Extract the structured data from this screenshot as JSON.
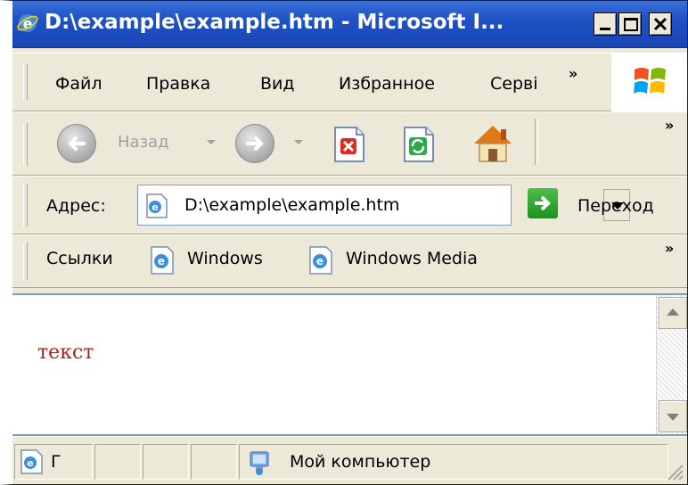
{
  "window": {
    "title": "D:\\example\\example.htm - Microsoft I...",
    "title_bar_color": "#1f52c6"
  },
  "menubar": {
    "items": [
      "Файл",
      "Правка",
      "Вид",
      "Избранное",
      "Серві"
    ],
    "chevron": "»"
  },
  "toolbar": {
    "back_label": "Назад",
    "chevron": "»",
    "icons": [
      "back-icon",
      "forward-icon",
      "stop-icon",
      "refresh-icon",
      "home-icon"
    ]
  },
  "addressbar": {
    "label": "Адрес:",
    "value": "D:\\example\\example.htm",
    "go_label": "Переход"
  },
  "linksbar": {
    "label": "Ссылки",
    "links": [
      "Windows",
      "Windows Media"
    ],
    "chevron": "»"
  },
  "content": {
    "text": "текст",
    "text_color": "#b22222"
  },
  "statusbar": {
    "first_char": "Г",
    "zone": "Мой компьютер"
  }
}
